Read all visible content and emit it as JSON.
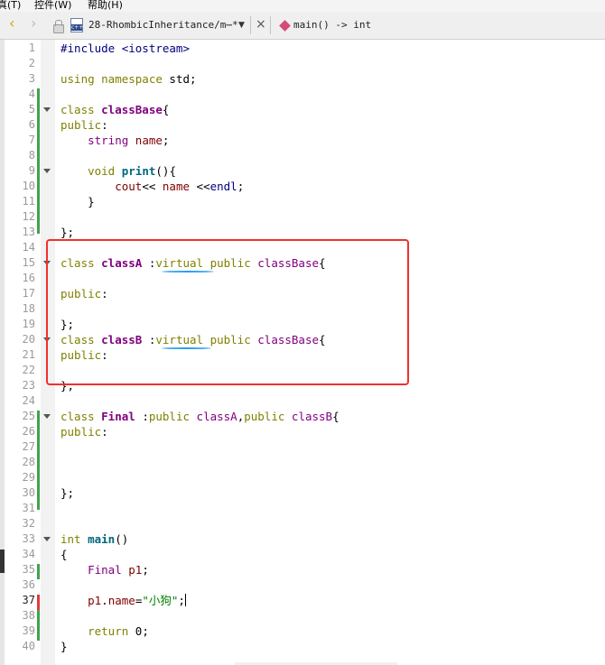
{
  "menubar": {
    "items": [
      "真(T)",
      "控件(W)",
      "帮助(H)"
    ]
  },
  "toolbar": {
    "file_name": "28-RhombicInheritance/m⋯*",
    "function_name": "main() -> int",
    "dropdown_glyph": "▼",
    "back_glyph": "‹",
    "forward_glyph": "›",
    "close_glyph": "×"
  },
  "editor": {
    "current_line": 37,
    "lines": [
      {
        "n": "1",
        "tokens": [
          [
            "pp",
            "#include <iostream>"
          ]
        ]
      },
      {
        "n": "2",
        "tokens": []
      },
      {
        "n": "3",
        "tokens": [
          [
            "kw",
            "using namespace "
          ],
          [
            "plain",
            "std"
          ],
          [
            "plain",
            ";"
          ]
        ]
      },
      {
        "n": "4",
        "tokens": []
      },
      {
        "n": "5",
        "tokens": [
          [
            "kw",
            "class "
          ],
          [
            "cls",
            "classBase"
          ],
          [
            "plain",
            "{"
          ]
        ]
      },
      {
        "n": "6",
        "tokens": [
          [
            "kw",
            "public"
          ],
          [
            "plain",
            ":"
          ]
        ]
      },
      {
        "n": "7",
        "tokens": [
          [
            "plain",
            "    "
          ],
          [
            "typ",
            "string "
          ],
          [
            "var",
            "name"
          ],
          [
            "plain",
            ";"
          ]
        ]
      },
      {
        "n": "8",
        "tokens": []
      },
      {
        "n": "9",
        "tokens": [
          [
            "plain",
            "    "
          ],
          [
            "kw",
            "void "
          ],
          [
            "fn",
            "print"
          ],
          [
            "plain",
            "(){"
          ]
        ]
      },
      {
        "n": "10",
        "tokens": [
          [
            "plain",
            "        "
          ],
          [
            "var",
            "cout"
          ],
          [
            "plain",
            "<< "
          ],
          [
            "var",
            "name"
          ],
          [
            "plain",
            " <<"
          ],
          [
            "pp",
            "endl"
          ],
          [
            "plain",
            ";"
          ]
        ]
      },
      {
        "n": "11",
        "tokens": [
          [
            "plain",
            "    }"
          ]
        ]
      },
      {
        "n": "12",
        "tokens": []
      },
      {
        "n": "13",
        "tokens": [
          [
            "plain",
            "};"
          ]
        ]
      },
      {
        "n": "14",
        "tokens": []
      },
      {
        "n": "15",
        "tokens": [
          [
            "kw",
            "class "
          ],
          [
            "cls",
            "classA"
          ],
          [
            "plain",
            " :"
          ],
          [
            "kw",
            "virtual public "
          ],
          [
            "typ",
            "classBase"
          ],
          [
            "plain",
            "{"
          ]
        ]
      },
      {
        "n": "16",
        "tokens": []
      },
      {
        "n": "17",
        "tokens": [
          [
            "kw",
            "public"
          ],
          [
            "plain",
            ":"
          ]
        ]
      },
      {
        "n": "18",
        "tokens": []
      },
      {
        "n": "19",
        "tokens": [
          [
            "plain",
            "};"
          ]
        ]
      },
      {
        "n": "20",
        "tokens": [
          [
            "kw",
            "class "
          ],
          [
            "cls",
            "classB"
          ],
          [
            "plain",
            " :"
          ],
          [
            "kw",
            "virtual public "
          ],
          [
            "typ",
            "classBase"
          ],
          [
            "plain",
            "{"
          ]
        ]
      },
      {
        "n": "21",
        "tokens": [
          [
            "kw",
            "public"
          ],
          [
            "plain",
            ":"
          ]
        ]
      },
      {
        "n": "22",
        "tokens": []
      },
      {
        "n": "23",
        "tokens": [
          [
            "plain",
            "};"
          ]
        ]
      },
      {
        "n": "24",
        "tokens": []
      },
      {
        "n": "25",
        "tokens": [
          [
            "kw",
            "class "
          ],
          [
            "cls",
            "Final"
          ],
          [
            "plain",
            " :"
          ],
          [
            "kw",
            "public "
          ],
          [
            "typ",
            "classA"
          ],
          [
            "plain",
            ","
          ],
          [
            "kw",
            "public "
          ],
          [
            "typ",
            "classB"
          ],
          [
            "plain",
            "{"
          ]
        ]
      },
      {
        "n": "26",
        "tokens": [
          [
            "kw",
            "public"
          ],
          [
            "plain",
            ":"
          ]
        ]
      },
      {
        "n": "27",
        "tokens": []
      },
      {
        "n": "28",
        "tokens": []
      },
      {
        "n": "29",
        "tokens": []
      },
      {
        "n": "30",
        "tokens": [
          [
            "plain",
            "};"
          ]
        ]
      },
      {
        "n": "31",
        "tokens": []
      },
      {
        "n": "32",
        "tokens": []
      },
      {
        "n": "33",
        "tokens": [
          [
            "kw",
            "int "
          ],
          [
            "fn",
            "main"
          ],
          [
            "plain",
            "()"
          ]
        ]
      },
      {
        "n": "34",
        "tokens": [
          [
            "plain",
            "{"
          ]
        ]
      },
      {
        "n": "35",
        "tokens": [
          [
            "plain",
            "    "
          ],
          [
            "typ",
            "Final "
          ],
          [
            "var",
            "p1"
          ],
          [
            "plain",
            ";"
          ]
        ]
      },
      {
        "n": "36",
        "tokens": []
      },
      {
        "n": "37",
        "tokens": [
          [
            "plain",
            "    "
          ],
          [
            "var",
            "p1"
          ],
          [
            "plain",
            "."
          ],
          [
            "var",
            "name"
          ],
          [
            "plain",
            "="
          ],
          [
            "str",
            "\"小狗\""
          ],
          [
            "plain",
            ";"
          ]
        ]
      },
      {
        "n": "38",
        "tokens": []
      },
      {
        "n": "39",
        "tokens": [
          [
            "plain",
            "    "
          ],
          [
            "kw",
            "return "
          ],
          [
            "plain",
            "0;"
          ]
        ]
      },
      {
        "n": "40",
        "tokens": [
          [
            "plain",
            "}"
          ]
        ]
      }
    ]
  },
  "colors": {
    "keyword": "#808000",
    "type": "#800080",
    "function": "#00677c",
    "string": "#008000",
    "highlight_box": "#f03030",
    "underline": "#2a9cf0"
  }
}
